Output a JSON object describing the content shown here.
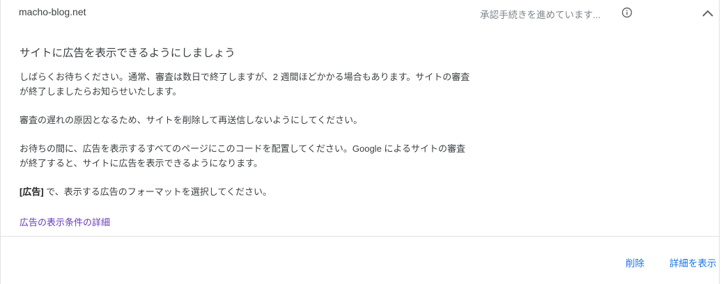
{
  "header": {
    "site_name": "macho-blog.net",
    "status_text": "承認手続きを進めています...",
    "info_icon": "info-icon",
    "collapse_icon": "chevron-up-icon"
  },
  "main": {
    "heading": "サイトに広告を表示できるようにしましょう",
    "para1": "しばらくお待ちください。通常、審査は数日で終了しますが、2 週間ほどかかる場合もあります。サイトの審査が終了しましたらお知らせいたします。",
    "para2": "審査の遅れの原因となるため、サイトを削除して再送信しないようにしてください。",
    "para3": "お待ちの間に、広告を表示するすべてのページにこのコードを配置してください。Google によるサイトの審査が終了すると、サイトに広告を表示できるようになります。",
    "para4_bold": "[広告]",
    "para4_rest": " で、表示する広告のフォーマットを選択してください。",
    "link": "広告の表示条件の詳細"
  },
  "footer": {
    "delete_label": "削除",
    "details_label": "詳細を表示"
  },
  "colors": {
    "link_purple": "#673ab7",
    "action_blue": "#1a73e8",
    "status_gray": "#80868b"
  }
}
